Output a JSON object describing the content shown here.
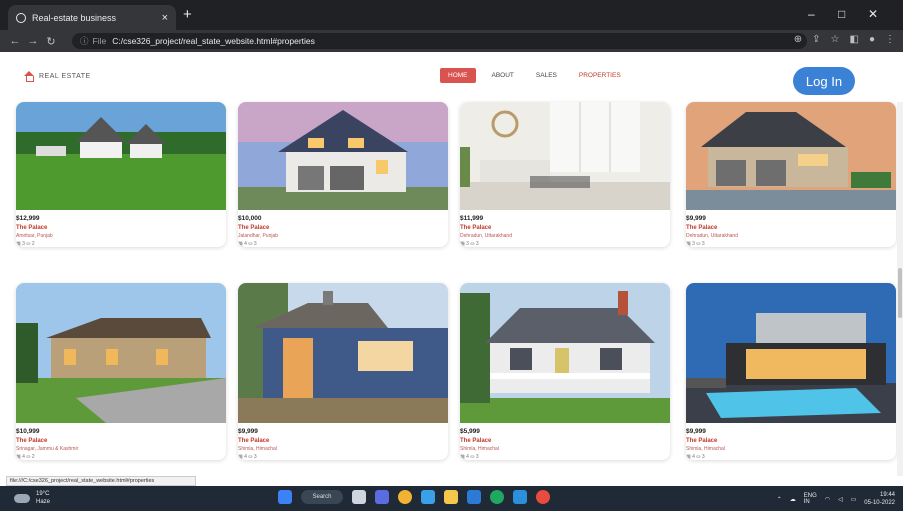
{
  "browser": {
    "tab_title": "Real-estate business",
    "tab_close": "×",
    "new_tab": "+",
    "url_prefix": "File",
    "url": "C:/cse326_project/real_state_website.html#properties",
    "min": "–",
    "max": "□",
    "close": "✕"
  },
  "header": {
    "brand": "REAL ESTATE",
    "nav": [
      "HOME",
      "ABOUT",
      "SALES",
      "PROPERTIES"
    ],
    "login": "Log In"
  },
  "properties_row1": [
    {
      "price": "$12,999",
      "title": "The Palace",
      "location": "Amritsar, Punjab",
      "meta": "▦ 3  ⛀ 2"
    },
    {
      "price": "$10,000",
      "title": "The Palace",
      "location": "Jalandhar, Punjab",
      "meta": "▦ 4  ⛀ 3"
    },
    {
      "price": "$11,999",
      "title": "The Palace",
      "location": "Dehradun, Uttarakhand",
      "meta": "▦ 3  ⛀ 3"
    },
    {
      "price": "$9,999",
      "title": "The Palace",
      "location": "Dehradun, Uttarakhand",
      "meta": "▦ 3  ⛀ 3"
    }
  ],
  "properties_row2": [
    {
      "price": "$10,999",
      "title": "The Palace",
      "location": "Srinagar, Jammu & Kashmir",
      "meta": "▦ 4  ⛀ 2"
    },
    {
      "price": "$9,999",
      "title": "The Palace",
      "location": "Shimla, Himachal",
      "meta": "▦ 4  ⛀ 3"
    },
    {
      "price": "$5,999",
      "title": "The Palace",
      "location": "Shimla, Himachal",
      "meta": "▦ 4  ⛀ 3"
    },
    {
      "price": "$9,999",
      "title": "The Palace",
      "location": "Shimla, Himachal",
      "meta": "▦ 4  ⛀ 3"
    }
  ],
  "status_url": "file:///C:/cse326_project/real_state_website.html#properties",
  "taskbar": {
    "temp": "19°C",
    "weather": "Haze",
    "search": "Search",
    "lang": "ENG",
    "region": "IN",
    "time": "19:44",
    "date": "05-10-2022"
  }
}
